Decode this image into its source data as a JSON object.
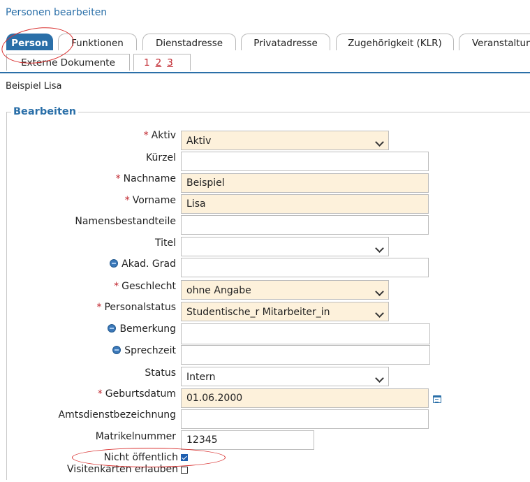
{
  "page": {
    "title": "Personen bearbeiten",
    "person_name": "Beispiel  Lisa"
  },
  "tabs": [
    {
      "label": "Person",
      "active": true
    },
    {
      "label": "Funktionen"
    },
    {
      "label": "Dienstadresse"
    },
    {
      "label": "Privatadresse"
    },
    {
      "label": "Zugehörigkeit (KLR)"
    },
    {
      "label": "Veranstaltungen"
    }
  ],
  "tabs_row2": {
    "label": "Externe Dokumente",
    "pages": [
      "1",
      "2",
      "3"
    ]
  },
  "section": {
    "legend": "Bearbeiten"
  },
  "form": {
    "aktiv": {
      "label": "Aktiv",
      "value": "Aktiv",
      "required": true
    },
    "kuerzel": {
      "label": "Kürzel",
      "value": ""
    },
    "nachname": {
      "label": "Nachname",
      "value": "Beispiel",
      "required": true
    },
    "vorname": {
      "label": "Vorname",
      "value": "Lisa",
      "required": true
    },
    "namensbestandteile": {
      "label": "Namensbestandteile",
      "value": ""
    },
    "titel": {
      "label": "Titel",
      "value": ""
    },
    "akad_grad": {
      "label": "Akad. Grad",
      "value": ""
    },
    "geschlecht": {
      "label": "Geschlecht",
      "value": "ohne Angabe",
      "required": true
    },
    "personalstatus": {
      "label": "Personalstatus",
      "value": "Studentische_r Mitarbeiter_in",
      "required": true
    },
    "bemerkung": {
      "label": "Bemerkung",
      "value": ""
    },
    "sprechzeit": {
      "label": "Sprechzeit",
      "value": ""
    },
    "status": {
      "label": "Status",
      "value": "Intern"
    },
    "geburtsdatum": {
      "label": "Geburtsdatum",
      "value": "01.06.2000",
      "required": true
    },
    "amtsdienstbezeichnung": {
      "label": "Amtsdienstbezeichnung",
      "value": ""
    },
    "matrikelnummer": {
      "label": "Matrikelnummer",
      "value": "12345"
    },
    "nicht_oeffentlich": {
      "label": "Nicht öffentlich",
      "checked": true
    },
    "visitenkarten": {
      "label": "Visitenkarten erlauben",
      "checked": false
    }
  },
  "required_mark": "*",
  "icons": {
    "translation": "globe-icon",
    "calendar": "calendar-icon",
    "dropdown": "chevron-down-icon"
  },
  "colors": {
    "accent": "#2a6fa8",
    "required_bg": "#fdf1db",
    "required_star": "#c0262e",
    "annotation": "#d9302f"
  }
}
